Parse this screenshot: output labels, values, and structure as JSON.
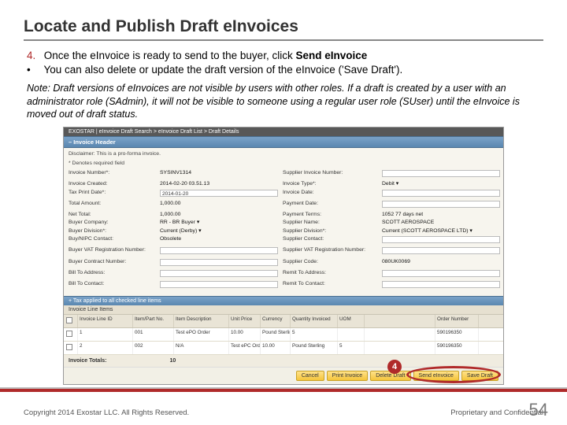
{
  "title": "Locate and Publish Draft eInvoices",
  "step4_num": "4.",
  "step4_text_a": "Once the eInvoice is ready to send to the buyer, click ",
  "step4_bold": "Send eInvoice",
  "bullet_char": "•",
  "bullet_text": "You can also delete or update the draft version of the eInvoice ('Save Draft').",
  "note": "Note:  Draft versions of eInvoices are not visible by users with other roles.  If a draft is created by a user with an administrator role (SAdmin), it will not be visible to someone using a regular user role (SUser) until the eInvoice is moved out of draft status.",
  "crumb": "EXOSTAR | eInvoice Draft Search > eInvoice Draft List > Draft Details",
  "sec_header": "– Invoice Header",
  "disclaimer1": "Disclaimer: This is a pro-forma invoice.",
  "disclaimer2": "* Denotes required field",
  "hdr": {
    "invnum_l": "Invoice Number*:",
    "invnum_v": "SYSINV1314",
    "supinv_l": "Supplier Invoice Number:",
    "created_l": "Invoice Created:",
    "created_v": "2014-02-20 03.51.13",
    "invtype_l": "Invoice Type*:",
    "invtype_v": "Debit ▾",
    "taxdate_l": "Tax Print Date*:",
    "taxdate_v": "2014-01-20",
    "invdate_l": "Invoice Date:",
    "totamt_l": "Total Amount:",
    "totamt_v": "1,000.00",
    "paydate_l": "Payment Date:",
    "nettot_l": "Net Total:",
    "nettot_v": "1,000.00",
    "payterm_l": "Payment Terms:",
    "payterm_v": "1052 77 days net",
    "buyco_l": "Buyer Company:",
    "buyco_v": "RR - BR Buyer ▾",
    "supname_l": "Supplier Name:",
    "supname_v": "SCOTT AEROSPACE",
    "buydiv_l": "Buyer Division*:",
    "buydiv_v": "Current (Derby) ▾",
    "supdiv_l": "Supplier Division*:",
    "supdiv_v": "Current (SCOTT AEROSPACE LTD) ▾",
    "buycon_l": "Buy/NIPC Contact:",
    "buycon_v": "Obsolete",
    "supcon_l": "Supplier Contact:",
    "buyvat_l": "Buyer VAT Registration Number:",
    "supvat_l": "Supplier VAT Registration Number:",
    "buyctr_l": "Buyer Contract Number:",
    "supcode_l": "Supplier Code:",
    "supcode_v": "080UK0069",
    "billfrom_l": "Bill To Address:",
    "remit_l": "Remit To Address:",
    "billto_l": "Bill To Contact:",
    "remitcon_l": "Remit To Contact:"
  },
  "tax_bar": "+ Tax applied to all checked line items",
  "li_bar": "Invoice Line Items",
  "grid_head": [
    "",
    "Invoice Line ID",
    "Item/Part No.",
    "Item Description",
    "Unit Price",
    "Currency",
    "Quantity Invoiced",
    "UOM",
    "",
    "Order Number"
  ],
  "rows": [
    [
      "",
      "1",
      "001",
      "Test ePO Order",
      "10.00",
      "Pound Sterling",
      "5",
      "",
      "",
      "590196350"
    ],
    [
      "",
      "2",
      "002",
      "N/A",
      "Test ePC Order",
      "10.00",
      "Pound Sterling",
      "5",
      "",
      "590196350"
    ]
  ],
  "totals_label": "Invoice Totals:",
  "totals_val": "10",
  "buttons": {
    "cancel": "Cancel",
    "print": "Print Invoice",
    "delete": "Delete Draft",
    "send": "Send eInvoice",
    "save": "Save Draft"
  },
  "callout_num": "4",
  "footer_left": "Copyright 2014 Exostar LLC. All Rights Reserved.",
  "footer_right": "Proprietary and Confidential",
  "page_num": "54"
}
